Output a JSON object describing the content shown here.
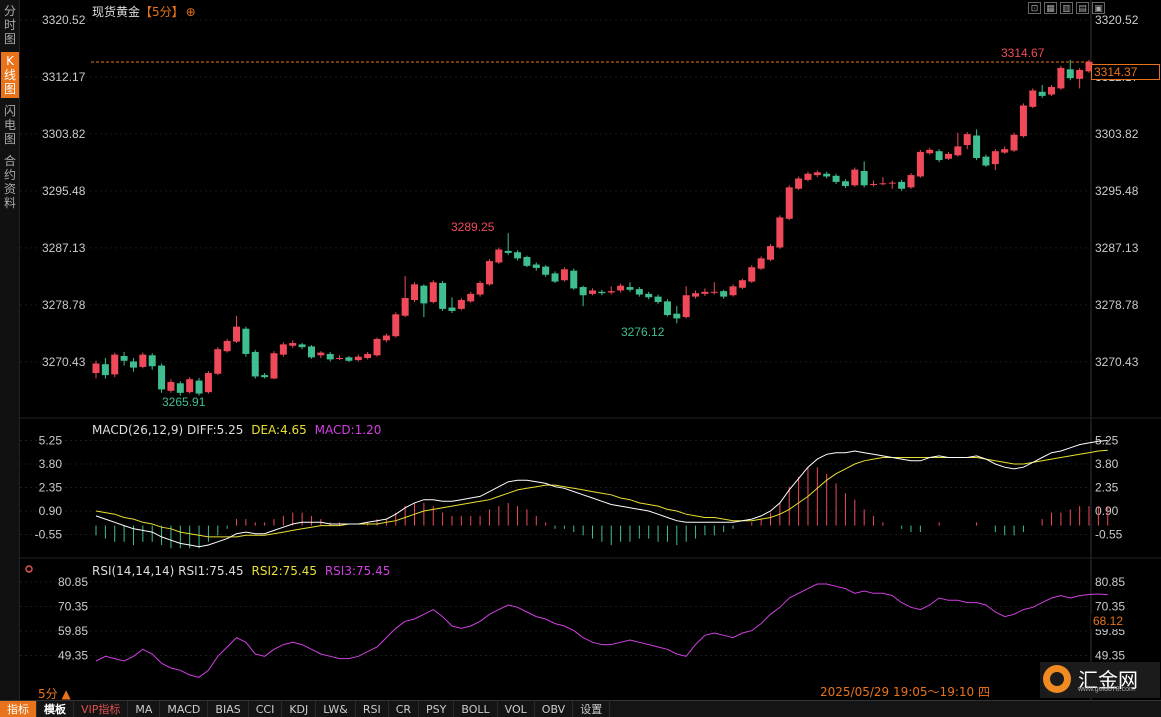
{
  "left_tabs": [
    {
      "label": "分时图",
      "active": false
    },
    {
      "label": "K线图",
      "active": true
    },
    {
      "label": "闪电图",
      "active": false
    },
    {
      "label": "合约资料",
      "active": false
    }
  ],
  "title": {
    "name": "现货黄金",
    "period": "【5分】",
    "plus": "⊕"
  },
  "window_buttons": [
    "⊡",
    "▦",
    "▥",
    "▤",
    "▣"
  ],
  "price_axis": {
    "ticks": [
      "3320.52",
      "3312.17",
      "3303.82",
      "3295.48",
      "3287.13",
      "3278.78",
      "3270.43"
    ],
    "current_price": "3314.37"
  },
  "annotations": {
    "high": "3314.67",
    "mid_high": "3289.25",
    "low_left": "3265.91",
    "low_mid": "3276.12"
  },
  "macd": {
    "label": "MACD(26,12,9)",
    "diff": "DIFF:5.25",
    "dea": "DEA:4.65",
    "macd": "MACD:1.20",
    "ticks": [
      "5.25",
      "3.80",
      "2.35",
      "0.90",
      "-0.55"
    ]
  },
  "rsi": {
    "label": "RSI(14,14,14)",
    "rsi1": "RSI1:75.45",
    "rsi2": "RSI2:75.45",
    "rsi3": "RSI3:75.45",
    "ticks": [
      "80.85",
      "70.35",
      "59.85",
      "49.35"
    ],
    "current": "68.12"
  },
  "colors": {
    "up": "#f04a5a",
    "down": "#3fbf8f",
    "accent": "#e8731a",
    "diff": "#ffffff",
    "dea": "#e8e030",
    "rsi": "#d040e0"
  },
  "period_selector": "5分 ▲",
  "datetime": "2025/05/29 19:05～19:10 四",
  "logo": {
    "name": "汇金网",
    "url": "www.gold678.com"
  },
  "bottom_tabs": [
    "指标",
    "模板",
    "VIP指标",
    "MA",
    "MACD",
    "BIAS",
    "CCI",
    "KDJ",
    "LW&",
    "RSI",
    "CR",
    "PSY",
    "BOLL",
    "VOL",
    "OBV",
    "设置"
  ],
  "chart_data": {
    "type": "candlestick",
    "title": "现货黄金【5分】",
    "ylim": [
      3262,
      3322
    ],
    "candles": [
      [
        3268.8,
        3270.2,
        3268.0,
        3270.6
      ],
      [
        3270.1,
        3268.5,
        3268.0,
        3271.0
      ],
      [
        3268.6,
        3271.5,
        3268.2,
        3271.8
      ],
      [
        3271.3,
        3270.6,
        3269.9,
        3271.9
      ],
      [
        3270.5,
        3269.6,
        3269.0,
        3271.0
      ],
      [
        3269.7,
        3271.5,
        3269.5,
        3271.8
      ],
      [
        3271.4,
        3269.8,
        3269.3,
        3271.7
      ],
      [
        3269.9,
        3266.4,
        3265.9,
        3270.2
      ],
      [
        3266.2,
        3267.5,
        3265.9,
        3267.9
      ],
      [
        3267.3,
        3265.9,
        3265.5,
        3267.6
      ],
      [
        3266.0,
        3267.9,
        3265.8,
        3268.2
      ],
      [
        3267.7,
        3265.8,
        3265.5,
        3268.1
      ],
      [
        3266.0,
        3268.8,
        3265.8,
        3269.1
      ],
      [
        3268.7,
        3272.3,
        3268.5,
        3272.6
      ],
      [
        3272.0,
        3273.5,
        3271.8,
        3273.8
      ],
      [
        3273.4,
        3275.6,
        3273.2,
        3277.2
      ],
      [
        3275.3,
        3271.6,
        3271.2,
        3275.6
      ],
      [
        3271.9,
        3268.3,
        3268.0,
        3272.2
      ],
      [
        3268.5,
        3268.2,
        3268.0,
        3268.8
      ],
      [
        3268.0,
        3271.7,
        3267.9,
        3272.0
      ],
      [
        3271.5,
        3273.0,
        3271.2,
        3273.3
      ],
      [
        3272.8,
        3273.2,
        3272.5,
        3273.6
      ],
      [
        3273.0,
        3272.6,
        3272.3,
        3273.2
      ],
      [
        3272.7,
        3271.1,
        3270.9,
        3272.9
      ],
      [
        3271.4,
        3271.8,
        3271.0,
        3272.0
      ],
      [
        3271.6,
        3270.8,
        3270.5,
        3271.9
      ],
      [
        3270.9,
        3271.0,
        3270.7,
        3271.4
      ],
      [
        3271.1,
        3270.6,
        3270.4,
        3271.3
      ],
      [
        3270.7,
        3271.2,
        3270.5,
        3271.5
      ],
      [
        3271.0,
        3271.6,
        3270.8,
        3271.9
      ],
      [
        3271.4,
        3273.8,
        3271.2,
        3274.0
      ],
      [
        3273.6,
        3274.3,
        3273.3,
        3274.6
      ],
      [
        3274.2,
        3277.4,
        3274.0,
        3277.7
      ],
      [
        3277.2,
        3279.8,
        3277.0,
        3283.0
      ],
      [
        3279.5,
        3281.8,
        3279.2,
        3282.1
      ],
      [
        3281.6,
        3279.0,
        3277.0,
        3281.8
      ],
      [
        3279.2,
        3282.1,
        3279.0,
        3282.4
      ],
      [
        3282.0,
        3278.2,
        3277.9,
        3282.3
      ],
      [
        3278.4,
        3277.9,
        3277.6,
        3279.9
      ],
      [
        3278.2,
        3279.5,
        3278.0,
        3279.8
      ],
      [
        3279.3,
        3280.4,
        3279.1,
        3280.7
      ],
      [
        3280.3,
        3282.0,
        3280.0,
        3282.3
      ],
      [
        3281.8,
        3285.2,
        3281.6,
        3285.5
      ],
      [
        3285.0,
        3286.9,
        3284.8,
        3287.2
      ],
      [
        3286.7,
        3286.4,
        3286.1,
        3289.3
      ],
      [
        3286.5,
        3285.6,
        3285.3,
        3286.8
      ],
      [
        3285.8,
        3284.5,
        3284.3,
        3286.0
      ],
      [
        3284.7,
        3284.2,
        3283.8,
        3285.0
      ],
      [
        3284.4,
        3283.2,
        3282.9,
        3284.6
      ],
      [
        3283.4,
        3282.2,
        3282.0,
        3283.7
      ],
      [
        3282.4,
        3284.0,
        3282.2,
        3284.3
      ],
      [
        3283.8,
        3281.2,
        3281.0,
        3284.1
      ],
      [
        3281.4,
        3280.2,
        3278.6,
        3281.6
      ],
      [
        3280.4,
        3280.9,
        3280.2,
        3281.2
      ],
      [
        3280.7,
        3280.5,
        3280.2,
        3281.0
      ],
      [
        3280.6,
        3280.8,
        3280.3,
        3281.5
      ],
      [
        3280.9,
        3281.6,
        3280.6,
        3281.9
      ],
      [
        3281.4,
        3281.0,
        3280.7,
        3282.1
      ],
      [
        3281.1,
        3280.3,
        3280.0,
        3281.4
      ],
      [
        3280.4,
        3279.9,
        3279.6,
        3280.7
      ],
      [
        3280.0,
        3279.2,
        3278.9,
        3280.3
      ],
      [
        3279.3,
        3277.3,
        3277.1,
        3279.6
      ],
      [
        3277.5,
        3276.8,
        3276.1,
        3278.6
      ],
      [
        3277.0,
        3280.2,
        3276.8,
        3281.5
      ],
      [
        3280.0,
        3280.5,
        3279.7,
        3280.9
      ],
      [
        3280.4,
        3280.7,
        3280.1,
        3281.2
      ],
      [
        3280.6,
        3280.7,
        3280.3,
        3282.1
      ],
      [
        3280.8,
        3280.0,
        3279.7,
        3281.0
      ],
      [
        3280.2,
        3281.5,
        3280.0,
        3281.8
      ],
      [
        3281.3,
        3282.4,
        3281.1,
        3282.6
      ],
      [
        3282.2,
        3284.3,
        3282.0,
        3284.6
      ],
      [
        3284.1,
        3285.6,
        3283.9,
        3285.9
      ],
      [
        3285.4,
        3287.4,
        3285.2,
        3287.7
      ],
      [
        3287.2,
        3291.6,
        3287.0,
        3291.9
      ],
      [
        3291.4,
        3296.0,
        3291.2,
        3296.3
      ],
      [
        3295.8,
        3297.3,
        3295.6,
        3297.6
      ],
      [
        3297.1,
        3298.0,
        3296.9,
        3298.3
      ],
      [
        3297.8,
        3298.2,
        3297.5,
        3298.5
      ],
      [
        3298.0,
        3297.6,
        3297.3,
        3298.3
      ],
      [
        3297.7,
        3296.8,
        3296.5,
        3298.0
      ],
      [
        3296.9,
        3296.2,
        3295.9,
        3297.2
      ],
      [
        3296.3,
        3298.6,
        3296.1,
        3298.9
      ],
      [
        3298.4,
        3296.3,
        3296.0,
        3299.8
      ],
      [
        3296.4,
        3296.5,
        3296.1,
        3297.0
      ],
      [
        3296.6,
        3296.6,
        3296.3,
        3297.5
      ],
      [
        3296.7,
        3296.7,
        3295.8,
        3297.0
      ],
      [
        3296.8,
        3295.8,
        3295.5,
        3297.1
      ],
      [
        3296.0,
        3297.8,
        3295.8,
        3298.1
      ],
      [
        3297.6,
        3301.2,
        3297.4,
        3301.5
      ],
      [
        3301.0,
        3301.5,
        3300.8,
        3301.8
      ],
      [
        3301.3,
        3300.0,
        3299.7,
        3301.6
      ],
      [
        3300.2,
        3300.9,
        3300.0,
        3301.2
      ],
      [
        3300.7,
        3302.0,
        3300.5,
        3304.0
      ],
      [
        3302.2,
        3303.8,
        3301.6,
        3304.1
      ],
      [
        3303.6,
        3300.3,
        3300.0,
        3304.5
      ],
      [
        3300.5,
        3299.2,
        3299.0,
        3300.8
      ],
      [
        3299.4,
        3301.3,
        3298.5,
        3301.6
      ],
      [
        3301.1,
        3301.6,
        3300.9,
        3302.0
      ],
      [
        3301.4,
        3303.7,
        3301.2,
        3304.0
      ],
      [
        3303.5,
        3308.0,
        3303.3,
        3308.3
      ],
      [
        3307.8,
        3310.2,
        3307.6,
        3310.5
      ],
      [
        3310.0,
        3309.4,
        3309.1,
        3311.0
      ],
      [
        3309.6,
        3310.7,
        3309.4,
        3311.0
      ],
      [
        3310.5,
        3313.5,
        3310.3,
        3313.8
      ],
      [
        3313.3,
        3312.0,
        3311.7,
        3314.7
      ],
      [
        3311.9,
        3313.2,
        3310.5,
        3313.5
      ],
      [
        3313.0,
        3314.4,
        3312.8,
        3314.7
      ]
    ],
    "macd_diff": [
      0.6,
      0.4,
      0.2,
      0.0,
      -0.2,
      -0.3,
      -0.4,
      -0.7,
      -0.9,
      -1.1,
      -1.2,
      -1.3,
      -1.2,
      -1.0,
      -0.8,
      -0.5,
      -0.4,
      -0.5,
      -0.5,
      -0.3,
      -0.1,
      0.1,
      0.2,
      0.2,
      0.2,
      0.1,
      0.1,
      0.1,
      0.1,
      0.2,
      0.3,
      0.4,
      0.7,
      1.1,
      1.4,
      1.6,
      1.6,
      1.5,
      1.5,
      1.6,
      1.7,
      1.8,
      2.1,
      2.4,
      2.7,
      2.8,
      2.8,
      2.7,
      2.6,
      2.4,
      2.3,
      2.1,
      1.9,
      1.7,
      1.5,
      1.3,
      1.2,
      1.1,
      1.0,
      0.9,
      0.7,
      0.5,
      0.3,
      0.2,
      0.2,
      0.2,
      0.2,
      0.2,
      0.2,
      0.3,
      0.4,
      0.6,
      0.9,
      1.4,
      2.2,
      2.9,
      3.6,
      4.1,
      4.4,
      4.5,
      4.5,
      4.6,
      4.5,
      4.4,
      4.3,
      4.2,
      4.1,
      4.0,
      4.0,
      4.2,
      4.3,
      4.2,
      4.2,
      4.2,
      4.3,
      4.1,
      3.8,
      3.6,
      3.5,
      3.6,
      3.9,
      4.2,
      4.5,
      4.6,
      4.8,
      5.0,
      5.1,
      5.2,
      5.25
    ],
    "macd_dea": [
      0.9,
      0.8,
      0.7,
      0.5,
      0.4,
      0.2,
      0.1,
      -0.1,
      -0.2,
      -0.4,
      -0.5,
      -0.6,
      -0.7,
      -0.7,
      -0.7,
      -0.7,
      -0.6,
      -0.6,
      -0.6,
      -0.5,
      -0.4,
      -0.3,
      -0.2,
      -0.1,
      0.0,
      0.0,
      0.0,
      0.1,
      0.1,
      0.1,
      0.1,
      0.2,
      0.3,
      0.5,
      0.7,
      0.9,
      1.0,
      1.1,
      1.2,
      1.3,
      1.4,
      1.5,
      1.6,
      1.8,
      2.0,
      2.2,
      2.3,
      2.4,
      2.5,
      2.5,
      2.4,
      2.3,
      2.2,
      2.1,
      2.0,
      1.9,
      1.7,
      1.6,
      1.4,
      1.3,
      1.2,
      1.0,
      0.9,
      0.7,
      0.6,
      0.5,
      0.5,
      0.4,
      0.3,
      0.3,
      0.3,
      0.4,
      0.5,
      0.7,
      1.0,
      1.4,
      1.8,
      2.3,
      2.8,
      3.2,
      3.5,
      3.8,
      4.0,
      4.1,
      4.2,
      4.2,
      4.2,
      4.2,
      4.2,
      4.2,
      4.2,
      4.2,
      4.2,
      4.2,
      4.2,
      4.1,
      4.0,
      3.9,
      3.8,
      3.8,
      3.9,
      4.0,
      4.1,
      4.2,
      4.3,
      4.4,
      4.5,
      4.6,
      4.65
    ],
    "rsi": [
      47,
      49,
      48,
      47,
      49,
      52,
      50,
      46,
      44,
      43,
      41,
      40,
      43,
      49,
      53,
      57,
      55,
      50,
      49,
      52,
      54,
      55,
      54,
      52,
      50,
      49,
      48,
      48,
      49,
      51,
      53,
      57,
      61,
      64,
      65,
      67,
      69,
      66,
      62,
      61,
      62,
      64,
      67,
      69,
      71,
      70,
      68,
      66,
      65,
      63,
      62,
      60,
      57,
      55,
      54,
      54,
      55,
      56,
      55,
      54,
      53,
      52,
      50,
      49,
      54,
      58,
      59,
      58,
      57,
      59,
      60,
      63,
      67,
      70,
      74,
      76,
      78,
      80,
      80,
      79,
      78,
      76,
      77,
      76,
      76,
      75,
      72,
      70,
      69,
      71,
      74,
      73,
      73,
      72,
      72,
      71,
      68,
      66,
      67,
      69,
      70,
      72,
      74,
      75,
      74,
      75,
      75.5,
      75.7,
      75.45
    ]
  }
}
